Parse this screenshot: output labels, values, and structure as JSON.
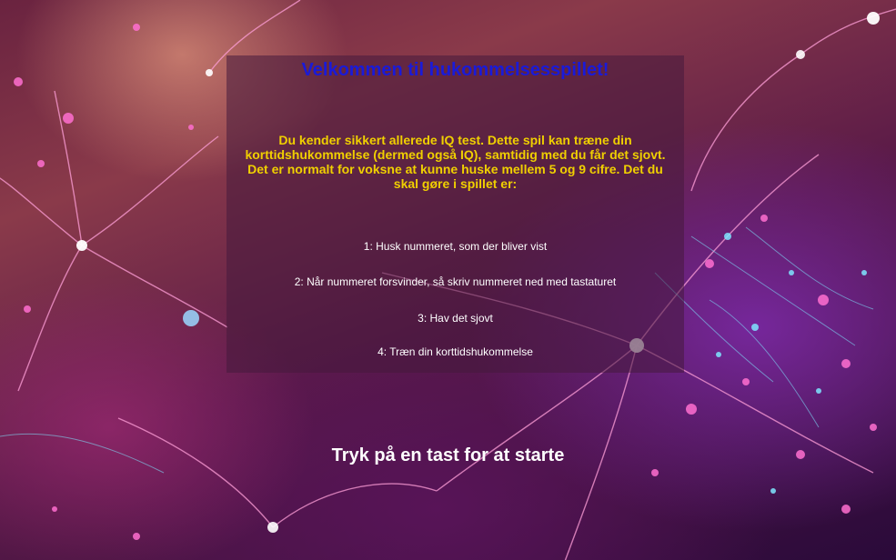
{
  "game": {
    "title": "Velkommen til hukommelsesspillet!",
    "intro": "Du kender sikkert allerede IQ test. Dette spil kan træne din korttidshukommelse (dermed også IQ), samtidig med du får det sjovt. Det er normalt for voksne at kunne huske mellem 5 og 9 cifre. Det du skal gøre i spillet er:",
    "steps": [
      "1: Husk nummeret, som der bliver vist",
      "2: Når nummeret forsvinder, så skriv nummeret ned med tastaturet",
      "3: Hav det sjovt",
      "4: Træn din korttidshukommelse"
    ],
    "start_prompt": "Tryk på en tast for at starte"
  },
  "colors": {
    "title": "#1a1ad8",
    "intro": "#f0d000",
    "steps": "#ffffff",
    "panel": "rgba(70,25,60,0.55)"
  },
  "background": {
    "icon": "neural-network-image"
  }
}
